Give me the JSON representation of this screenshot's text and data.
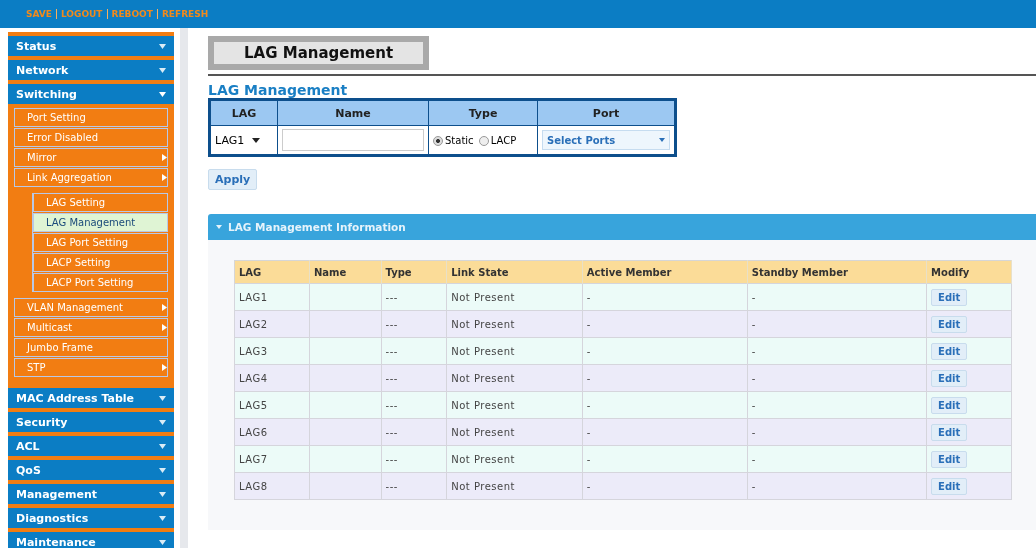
{
  "top_links": [
    "SAVE",
    "LOGOUT",
    "REBOOT",
    "REFRESH"
  ],
  "sidebar": [
    {
      "label": "Status",
      "expanded": false
    },
    {
      "label": "Network",
      "expanded": false
    },
    {
      "label": "Switching",
      "expanded": true,
      "children": [
        {
          "label": "Port Setting",
          "selected": false,
          "has_submenu": false
        },
        {
          "label": "Error Disabled",
          "selected": false,
          "has_submenu": false
        },
        {
          "label": "Mirror",
          "selected": false,
          "has_submenu": true
        },
        {
          "label": "Link Aggregation",
          "selected": false,
          "has_submenu": true,
          "children": [
            {
              "label": "LAG Setting",
              "selected": false
            },
            {
              "label": "LAG Management",
              "selected": true
            },
            {
              "label": "LAG Port Setting",
              "selected": false
            },
            {
              "label": "LACP Setting",
              "selected": false
            },
            {
              "label": "LACP Port Setting",
              "selected": false
            }
          ]
        },
        {
          "label": "VLAN Management",
          "selected": false,
          "has_submenu": true
        },
        {
          "label": "Multicast",
          "selected": false,
          "has_submenu": true
        },
        {
          "label": "Jumbo Frame",
          "selected": false,
          "has_submenu": false
        },
        {
          "label": "STP",
          "selected": false,
          "has_submenu": true
        }
      ]
    },
    {
      "label": "MAC Address Table",
      "expanded": false
    },
    {
      "label": "Security",
      "expanded": false
    },
    {
      "label": "ACL",
      "expanded": false
    },
    {
      "label": "QoS",
      "expanded": false
    },
    {
      "label": "Management",
      "expanded": false
    },
    {
      "label": "Diagnostics",
      "expanded": false
    },
    {
      "label": "Maintenance",
      "expanded": false
    }
  ],
  "page_title": "LAG Management",
  "form": {
    "title": "LAG Management",
    "columns": [
      "LAG",
      "Name",
      "Type",
      "Port"
    ],
    "lag": "LAG1",
    "type_options": [
      {
        "label": "Static",
        "selected": true
      },
      {
        "label": "LACP",
        "selected": false
      }
    ],
    "port": "Select Ports",
    "apply": "Apply"
  },
  "info": {
    "title": "LAG Management Information",
    "columns": [
      "LAG",
      "Name",
      "Type",
      "Link State",
      "Active Member",
      "Standby Member",
      "Modify"
    ],
    "rows": [
      [
        "LAG1",
        "",
        "---",
        "Not Present",
        "-",
        "-",
        "Edit"
      ],
      [
        "LAG2",
        "",
        "---",
        "Not Present",
        "-",
        "-",
        "Edit"
      ],
      [
        "LAG3",
        "",
        "---",
        "Not Present",
        "-",
        "-",
        "Edit"
      ],
      [
        "LAG4",
        "",
        "---",
        "Not Present",
        "-",
        "-",
        "Edit"
      ],
      [
        "LAG5",
        "",
        "---",
        "Not Present",
        "-",
        "-",
        "Edit"
      ],
      [
        "LAG6",
        "",
        "---",
        "Not Present",
        "-",
        "-",
        "Edit"
      ],
      [
        "LAG7",
        "",
        "---",
        "Not Present",
        "-",
        "-",
        "Edit"
      ],
      [
        "LAG8",
        "",
        "---",
        "Not Present",
        "-",
        "-",
        "Edit"
      ]
    ]
  }
}
